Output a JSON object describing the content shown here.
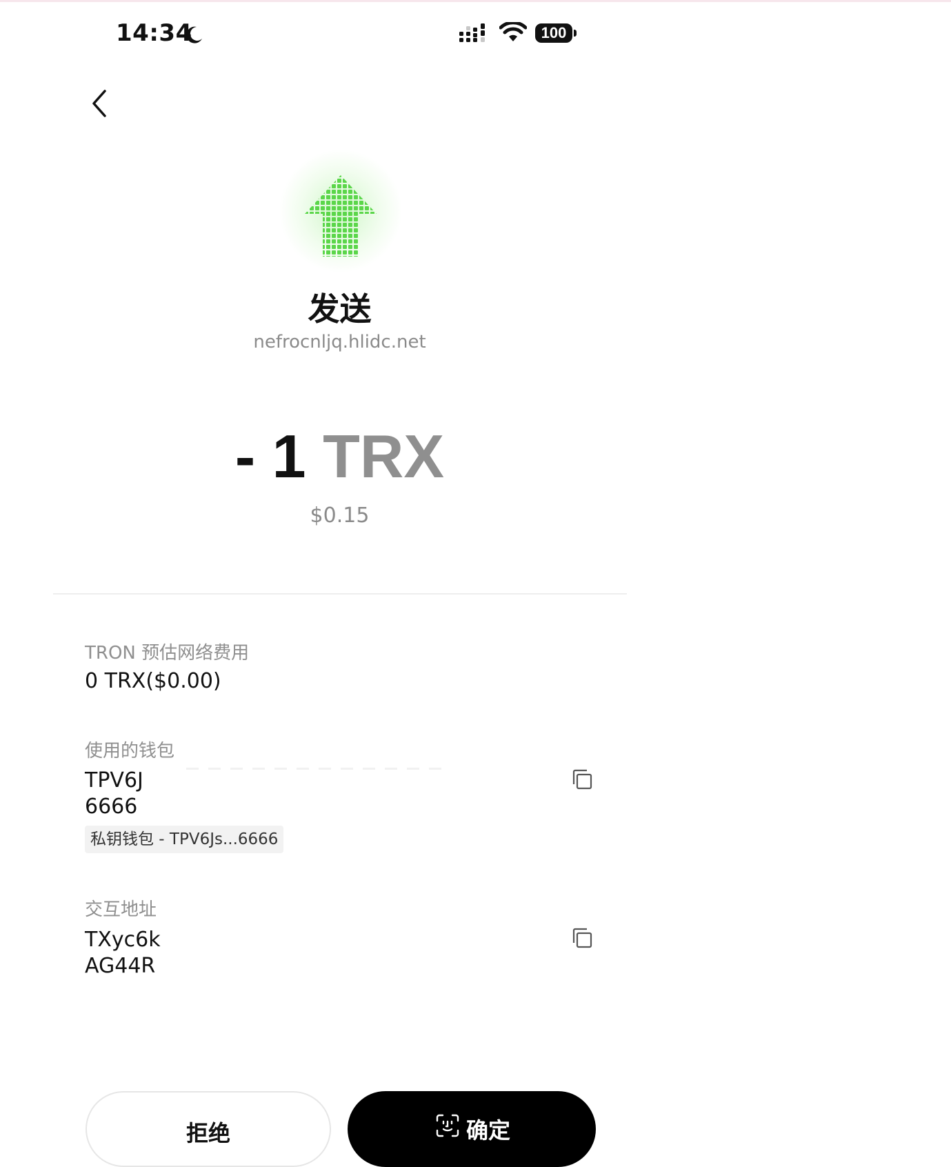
{
  "status_bar": {
    "time": "14:34",
    "battery": "100"
  },
  "icons": {
    "back": "chevron-left-icon",
    "hero": "arrow-up-icon",
    "moon": "moon-icon",
    "signal": "signal-icon",
    "wifi": "wifi-icon",
    "battery": "battery-icon",
    "copy": "copy-icon",
    "faceid": "faceid-icon"
  },
  "header": {
    "title": "发送",
    "subtitle": "nefrocnljq.hlidc.net"
  },
  "amount": {
    "value": "- 1 ",
    "unit": "TRX",
    "fiat": "$0.15"
  },
  "fee": {
    "label": "TRON 预估网络费用",
    "value": "0 TRX($0.00)"
  },
  "wallet": {
    "label": "使用的钱包",
    "line1": "TPV6J",
    "line2": "6666",
    "tag": "私钥钱包 - TPV6Js...6666"
  },
  "interaction": {
    "label": "交互地址",
    "line1": "TXyc6k",
    "line2": "AG44R"
  },
  "buttons": {
    "reject": "拒绝",
    "confirm": "确定"
  },
  "colors": {
    "accent_green": "#5bd64a",
    "primary_button": "#000000",
    "muted_text": "#8f8f8f"
  }
}
